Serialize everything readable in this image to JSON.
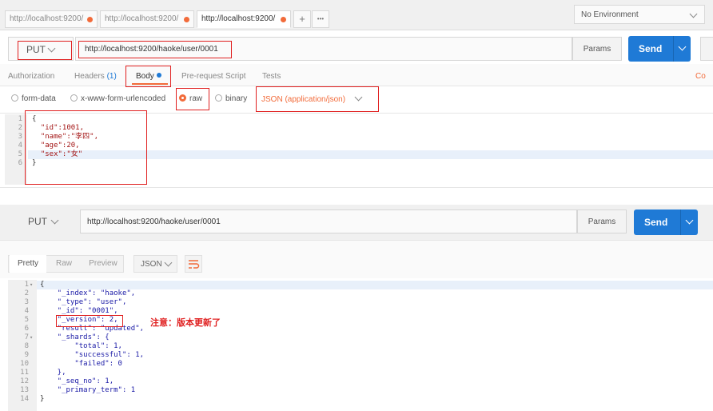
{
  "tabs": [
    {
      "label": "http://localhost:9200/"
    },
    {
      "label": "http://localhost:9200/"
    },
    {
      "label": "http://localhost:9200/"
    }
  ],
  "tab_add": "+",
  "tab_more": "•••",
  "environment": "No Environment",
  "request": {
    "method": "PUT",
    "url": "http://localhost:9200/haoke/user/0001",
    "params": "Params",
    "send": "Send"
  },
  "request_tabs": {
    "authorization": "Authorization",
    "headers": "Headers",
    "headers_count": "(1)",
    "body": "Body",
    "prerequest": "Pre-request Script",
    "tests": "Tests",
    "cookies_fragment": "Co"
  },
  "body_types": {
    "form_data": "form-data",
    "urlencoded": "x-www-form-urlencoded",
    "raw": "raw",
    "binary": "binary",
    "raw_format": "JSON (application/json)"
  },
  "request_body": {
    "line_numbers": [
      "1",
      "2",
      "3",
      "4",
      "5",
      "6"
    ],
    "lines": [
      "{",
      "  \"id\":1001,",
      "  \"name\":\"李四\",",
      "  \"age\":20,",
      "  \"sex\":\"女\"",
      "}"
    ]
  },
  "response_request": {
    "method": "PUT",
    "url": "http://localhost:9200/haoke/user/0001",
    "params": "Params",
    "send": "Send"
  },
  "response_view": {
    "pretty": "Pretty",
    "raw": "Raw",
    "preview": "Preview",
    "format": "JSON"
  },
  "response_body": {
    "line_numbers": [
      "1",
      "2",
      "3",
      "4",
      "5",
      "6",
      "7",
      "8",
      "9",
      "10",
      "11",
      "12",
      "13",
      "14"
    ],
    "lines": [
      "{",
      "    \"_index\": \"haoke\",",
      "    \"_type\": \"user\",",
      "    \"_id\": \"0001\",",
      "    \"_version\": 2,",
      "    \"result\": \"updated\",",
      "    \"_shards\": {",
      "        \"total\": 1,",
      "        \"successful\": 1,",
      "        \"failed\": 0",
      "    },",
      "    \"_seq_no\": 1,",
      "    \"_primary_term\": 1",
      "}"
    ]
  },
  "annotation": "注意：版本更新了",
  "colors": {
    "accent": "#f26b3a",
    "send": "#1f7ad6",
    "annotation": "#e02020"
  }
}
